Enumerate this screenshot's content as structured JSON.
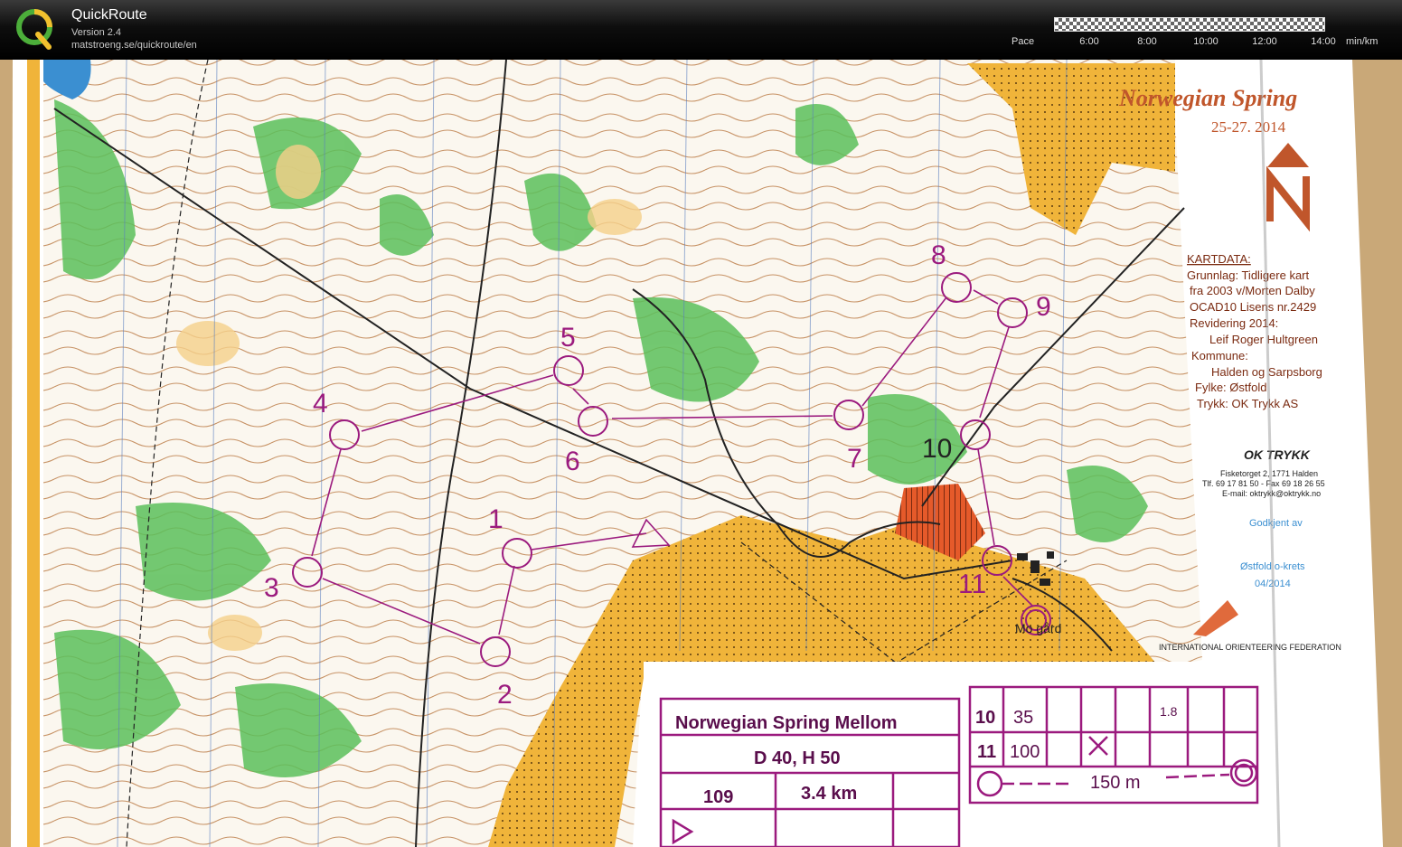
{
  "app": {
    "title": "QuickRoute",
    "version": "Version 2.4",
    "url": "matstroeng.se/quickroute/en",
    "logo_letter": "Q"
  },
  "pace_scale": {
    "label": "Pace",
    "ticks": [
      "6:00",
      "8:00",
      "10:00",
      "12:00",
      "14:00"
    ],
    "unit": "min/km"
  },
  "map": {
    "header_title": "Norwegian Spring",
    "header_date": "25-27. 2014",
    "kartdata_title": "KARTDATA:",
    "kartdata_lines": [
      "Grunnlag:  Tidligere kart",
      "fra 2003 v/Morten Dalby",
      "OCAD10 Lisens nr.2429",
      "Revidering 2014:",
      "Leif Roger Hultgreen",
      "Kommune:",
      "Halden og Sarpsborg",
      "Fylke:                 Østfold",
      "Trykk:        OK Trykk AS"
    ],
    "printer_logo": "OK TRYKK",
    "printer_address": "Fisketorget 2, 1771 Halden",
    "printer_phone": "Tlf. 69 17 81 50 - Fax 69 18 26 55",
    "printer_email": "E-mail: oktrykk@oktrykk.no",
    "approval_lines": [
      "Godkjent av",
      "Østfold o-krets",
      "04/2014"
    ],
    "federation": "INTERNATIONAL ORIENTEERING FEDERATION",
    "place_name": "Mo gård",
    "control_numbers": [
      "1",
      "2",
      "3",
      "4",
      "5",
      "6",
      "7",
      "8",
      "9",
      "10",
      "11"
    ],
    "course": {
      "title": "Norwegian Spring Mellom",
      "classes": "D 40, H 50",
      "course_code": "109",
      "length": "3.4 km"
    },
    "description_rows": [
      {
        "num": "10",
        "code": "35",
        "dim": "1.8"
      },
      {
        "num": "11",
        "code": "100"
      }
    ],
    "finish_distance": "150 m"
  },
  "colors": {
    "course_purple": "#9b1a7e",
    "topbar": "#000000",
    "open_land": "#f0b43a",
    "forest_green": "#5bbf5b",
    "contour_brown": "#b0672a"
  }
}
